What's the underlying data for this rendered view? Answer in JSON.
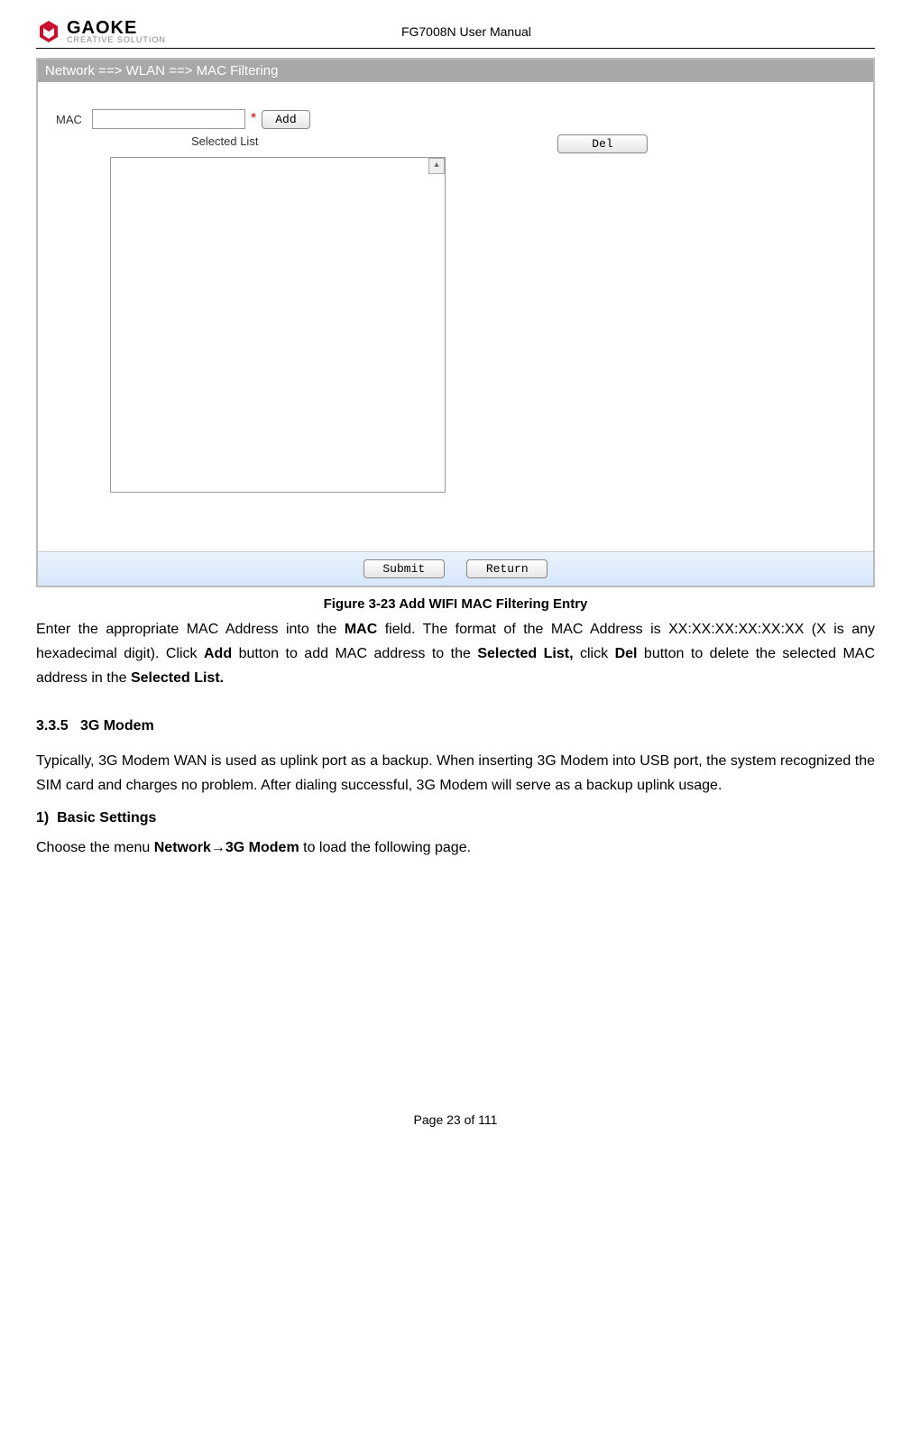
{
  "header": {
    "logo_text": "GAOKE",
    "logo_tag": "CREATIVE SOLUTION",
    "manual_title": "FG7008N User Manual"
  },
  "screenshot": {
    "breadcrumb": "Network ==> WLAN ==> MAC Filtering",
    "mac_label": "MAC",
    "mac_value": "",
    "required_mark": "*",
    "add_label": "Add",
    "selected_list_label": "Selected List",
    "del_label": "Del",
    "submit_label": "Submit",
    "return_label": "Return"
  },
  "caption": "Figure 3-23  Add WIFI MAC Filtering Entry",
  "para1": {
    "t1": "Enter the appropriate MAC Address into the ",
    "b1": "MAC",
    "t2": " field. The format of the MAC Address is XX:XX:XX:XX:XX:XX (X is any hexadecimal digit). Click ",
    "b2": "Add",
    "t3": " button to add MAC address to the ",
    "b3": "Selected List,",
    "t4": " click ",
    "b4": "Del",
    "t5": " button to delete the selected MAC address in the ",
    "b5": "Selected List.",
    "t6": ""
  },
  "section": {
    "num": "3.3.5",
    "title": "3G Modem"
  },
  "para2": "Typically, 3G Modem WAN is used as uplink port as a backup. When inserting 3G Modem into USB port, the system recognized the SIM card and charges no problem. After dialing successful, 3G Modem will serve as a backup uplink usage.",
  "sub": {
    "num": "1)",
    "title": "Basic Settings"
  },
  "para3": {
    "t1": "Choose the menu ",
    "b1": "Network→3G Modem",
    "t2": " to load the following page."
  },
  "footer": "Page 23 of 111"
}
